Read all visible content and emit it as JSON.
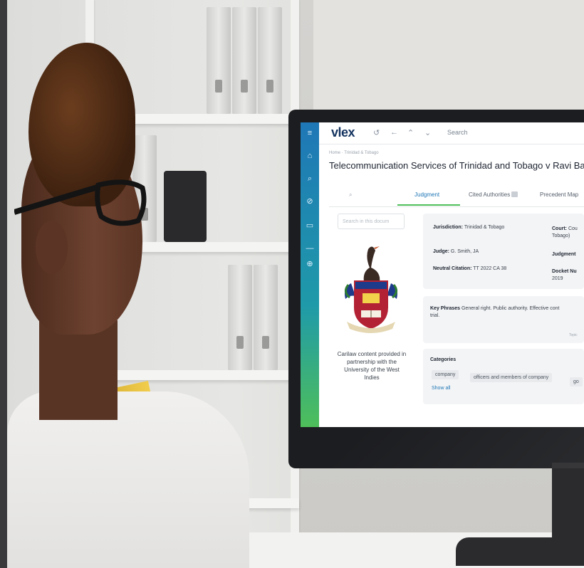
{
  "colors": {
    "sidebar_top": "#1f77b6",
    "sidebar_bottom": "#4fbf5a",
    "accent": "#1f77b6",
    "tab_underline": "#4fbf5a",
    "logo": "#13335f"
  },
  "app": {
    "logo": "vlex",
    "search_label": "Search",
    "icons": [
      "history-icon",
      "back-arrow-icon",
      "up-arrow-icon",
      "down-arrow-icon"
    ]
  },
  "sidebar": {
    "icons": [
      "menu-icon",
      "home-icon",
      "search-icon",
      "compass-icon",
      "chat-icon",
      "download-icon"
    ]
  },
  "document": {
    "breadcrumb": "Home · Trinidad & Tobago",
    "title": "Telecommunication Services of Trinidad and Tobago v Ravi Balgobin"
  },
  "tabs": [
    {
      "label": "Judgment"
    },
    {
      "label": "Cited Authorities"
    },
    {
      "label": "Precedent Map"
    }
  ],
  "left_panel": {
    "search_placeholder": "Search in this docum",
    "provided_text": "Carilaw content provided in partnership with the University of the West Indies"
  },
  "metadata": {
    "jurisdiction_label": "Jurisdiction:",
    "jurisdiction_value": "Trinidad & Tobago",
    "judge_label": "Judge:",
    "judge_value": "G. Smith, JA",
    "neutral_label": "Neutral Citation:",
    "neutral_value": "TT 2022 CA 38",
    "court_label": "Court:",
    "court_value": "Cou",
    "court_value_2": "Tobago)",
    "judgment_label": "Judgment",
    "docket_label": "Docket Nu",
    "docket_value": "2019"
  },
  "key_phrases": {
    "label": "Key Phrases",
    "text": "General right. Public authority. Effective cont",
    "text_2": "trial.",
    "topic": "Topic"
  },
  "categories": {
    "label": "Categories",
    "chips": [
      "company",
      "officers and members of company",
      "go"
    ],
    "show_all": "Show all"
  }
}
